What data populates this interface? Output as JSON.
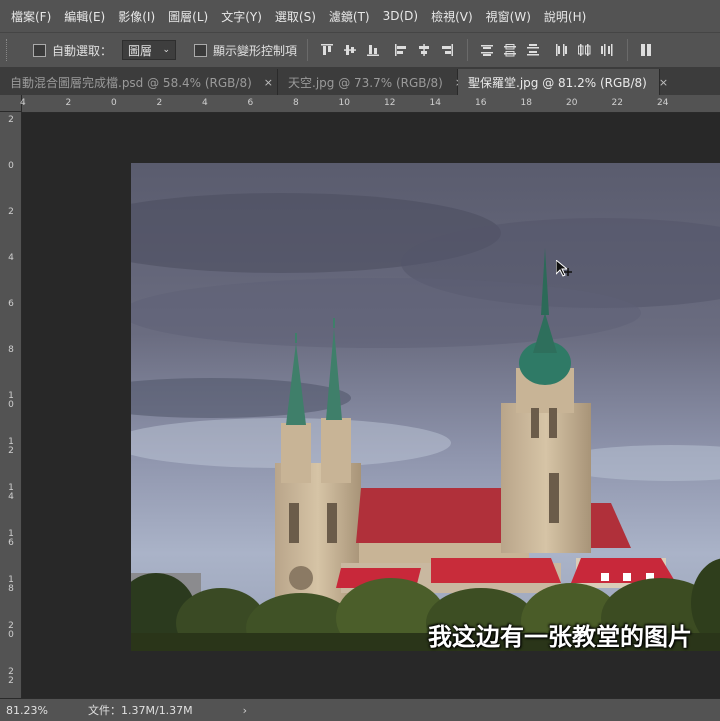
{
  "menubar": {
    "items": [
      {
        "label": "檔案(F)"
      },
      {
        "label": "編輯(E)"
      },
      {
        "label": "影像(I)"
      },
      {
        "label": "圖層(L)"
      },
      {
        "label": "文字(Y)"
      },
      {
        "label": "選取(S)"
      },
      {
        "label": "濾鏡(T)"
      },
      {
        "label": "3D(D)"
      },
      {
        "label": "檢視(V)"
      },
      {
        "label": "視窗(W)"
      },
      {
        "label": "說明(H)"
      }
    ]
  },
  "options": {
    "auto_select_label": "自動選取：",
    "auto_select_target": "圖層",
    "show_transform_label": "顯示變形控制項"
  },
  "tabs": [
    {
      "label": "自動混合圖層完成檔.psd @ 58.4% (RGB/8)",
      "close": "×"
    },
    {
      "label": "天空.jpg @ 73.7% (RGB/8)",
      "close": "×"
    },
    {
      "label": "聖保羅堂.jpg @ 81.2% (RGB/8)",
      "close": "×"
    }
  ],
  "ruler_top": [
    "4",
    "2",
    "0",
    "2",
    "4",
    "6",
    "8",
    "10",
    "12",
    "14",
    "16",
    "18",
    "20",
    "22",
    "24"
  ],
  "ruler_left": [
    "2",
    "0",
    "2",
    "4",
    "6",
    "8",
    "10",
    "12",
    "14",
    "16",
    "18",
    "20",
    "22"
  ],
  "canvas": {
    "subtitle": "我这边有一张教堂的图片"
  },
  "status": {
    "zoom": "81.23%",
    "doc_info": "文件：1.37M/1.37M",
    "arrow": "›"
  },
  "colors": {
    "chrome": "#535353",
    "canvas_bg": "#282828",
    "tab_bar": "#3c3c3c"
  }
}
